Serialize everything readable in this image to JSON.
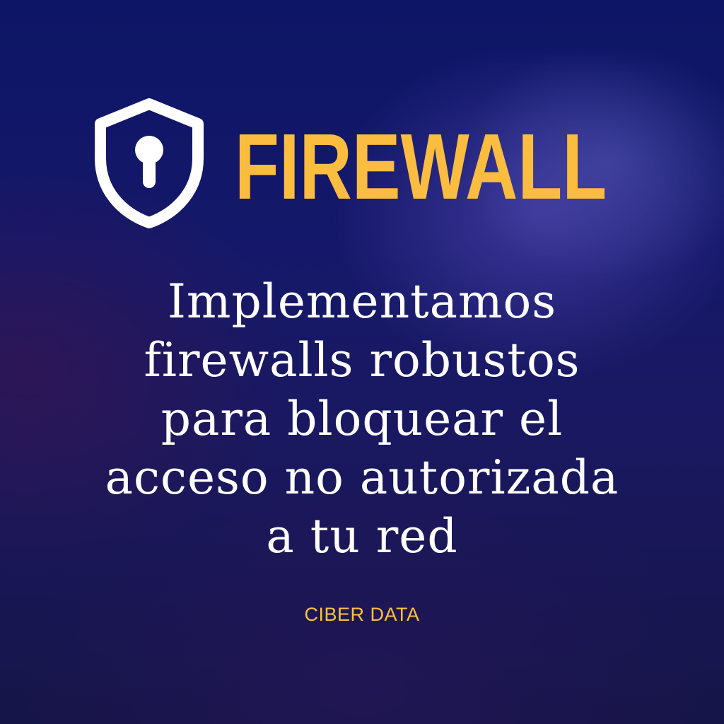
{
  "colors": {
    "accent": "#fbbd3f",
    "text": "#ffffff",
    "background": "#13176a"
  },
  "brand": {
    "icon": "shield-keyhole-icon",
    "title": "FIREWALL"
  },
  "headline": {
    "lines": [
      "Implementamos",
      "firewalls robustos",
      "para bloquear el",
      "acceso no autorizada",
      "a tu red"
    ]
  },
  "footer": {
    "company": "CIBER DATA"
  }
}
